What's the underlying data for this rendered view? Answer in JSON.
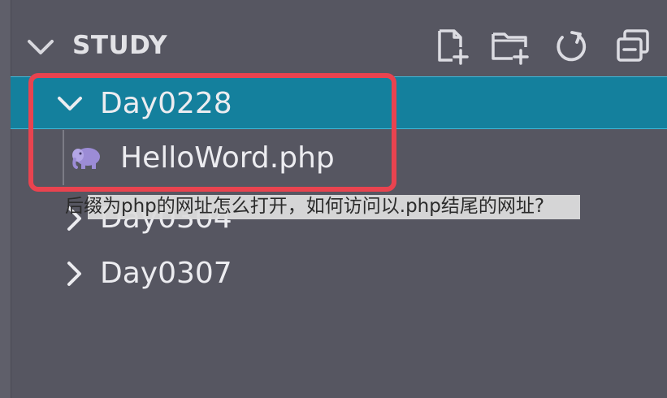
{
  "explorer": {
    "section_title": "STUDY",
    "items": [
      {
        "label": "Day0228",
        "expanded": true,
        "selected": true
      },
      {
        "label": "HelloWord.php",
        "icon": "php-elephant-icon"
      },
      {
        "label": "Day0304",
        "expanded": false
      },
      {
        "label": "Day0307",
        "expanded": false
      }
    ],
    "actions": [
      "new-file-icon",
      "new-folder-icon",
      "refresh-icon",
      "collapse-all-icon"
    ]
  },
  "caption": {
    "text": "后缀为php的网址怎么打开，如何访问以.php结尾的网址?"
  },
  "colors": {
    "background": "#565661",
    "selected_row": "#14809d",
    "highlight_border": "#e9434f",
    "php_icon": "#9c8cd6"
  }
}
